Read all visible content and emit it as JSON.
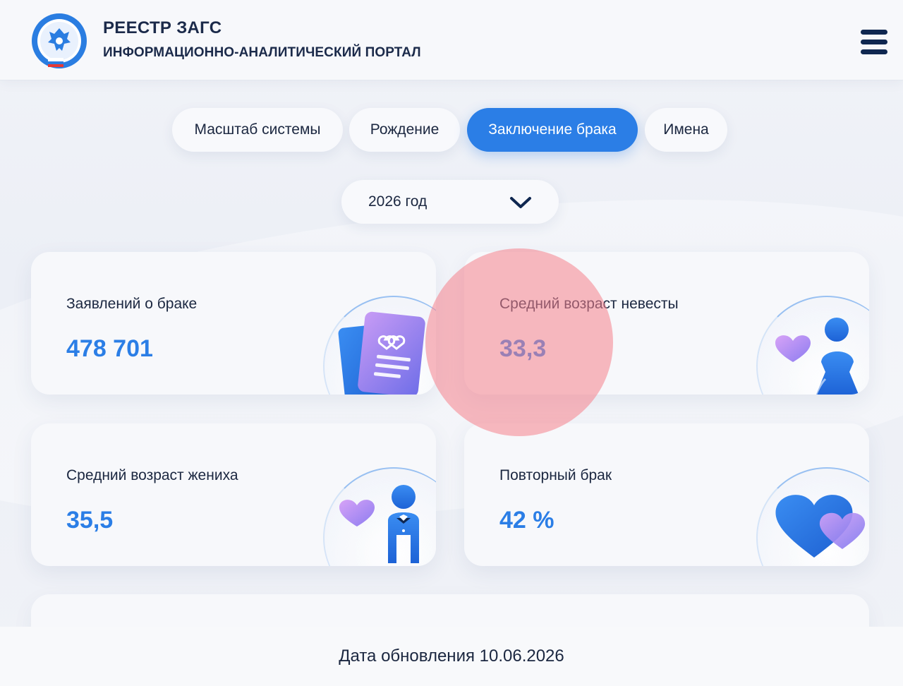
{
  "header": {
    "title": "РЕЕСТР ЗАГС",
    "subtitle": "ИНФОРМАЦИОННО-АНАЛИТИЧЕСКИЙ ПОРТАЛ",
    "logo_icon": "fns-emblem-icon",
    "menu_icon": "hamburger-menu-icon"
  },
  "tabs": [
    {
      "label": "Масштаб системы",
      "active": false
    },
    {
      "label": "Рождение",
      "active": false
    },
    {
      "label": "Заключение брака",
      "active": true
    },
    {
      "label": "Имена",
      "active": false
    }
  ],
  "year_select": {
    "value": "2026 год",
    "icon": "chevron-down-icon"
  },
  "cards": [
    {
      "label": "Заявлений о браке",
      "value": "478 701",
      "icon": "marriage-document-icon"
    },
    {
      "label": "Средний возраст невесты",
      "value": "33,3",
      "icon": "bride-icon"
    },
    {
      "label": "Средний возраст жениха",
      "value": "35,5",
      "icon": "groom-icon"
    },
    {
      "label": "Повторный брак",
      "value": "42 %",
      "icon": "two-hearts-icon"
    }
  ],
  "footer": {
    "updated": "Дата обновления 10.06.2026"
  },
  "colors": {
    "accent": "#2b7ee6",
    "text": "#1b2740",
    "touch_indicator": "#f5828c"
  }
}
